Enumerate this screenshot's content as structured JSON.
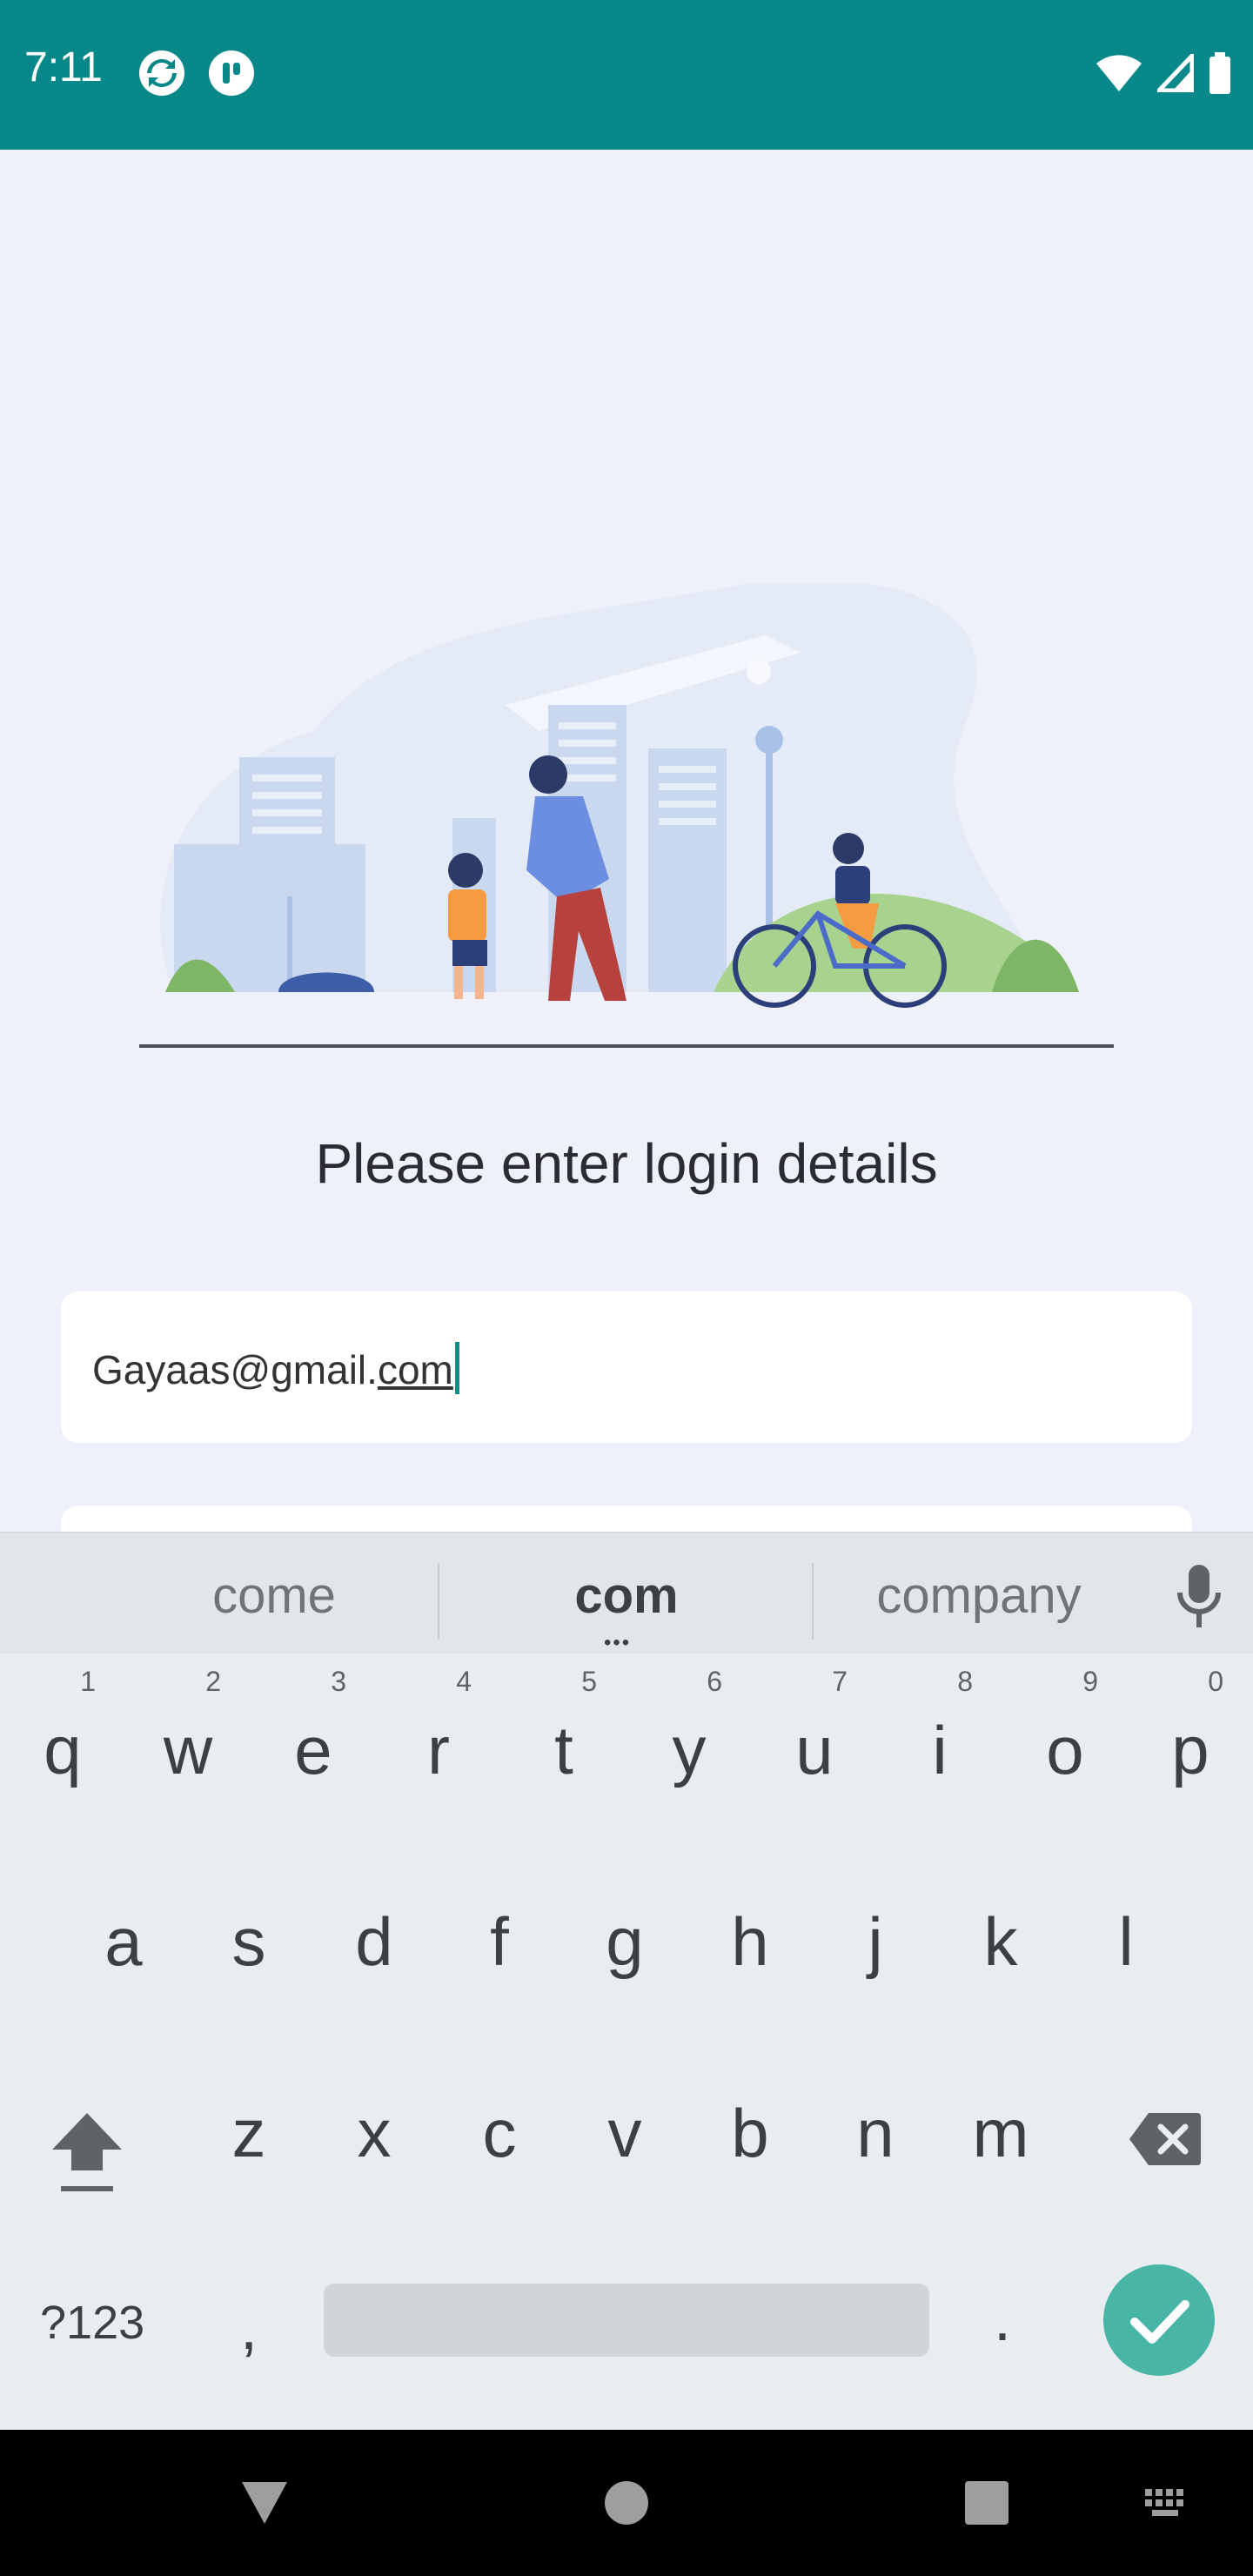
{
  "status_bar": {
    "time": "7:11",
    "icons_left": [
      "sync-icon",
      "app-notification-icon"
    ],
    "icons_right": [
      "wifi-icon",
      "signal-icon",
      "battery-icon"
    ],
    "color": "#088889"
  },
  "main": {
    "illustration": "family-park-scene",
    "heading": "Please enter login details",
    "email_field": {
      "value_prefix": "Gayaas@gmail.",
      "value_suffix": "com"
    }
  },
  "keyboard": {
    "suggestions": [
      "come",
      "com",
      "company"
    ],
    "row1": [
      {
        "key": "q",
        "hint": "1"
      },
      {
        "key": "w",
        "hint": "2"
      },
      {
        "key": "e",
        "hint": "3"
      },
      {
        "key": "r",
        "hint": "4"
      },
      {
        "key": "t",
        "hint": "5"
      },
      {
        "key": "y",
        "hint": "6"
      },
      {
        "key": "u",
        "hint": "7"
      },
      {
        "key": "i",
        "hint": "8"
      },
      {
        "key": "o",
        "hint": "9"
      },
      {
        "key": "p",
        "hint": "0"
      }
    ],
    "row2": [
      "a",
      "s",
      "d",
      "f",
      "g",
      "h",
      "j",
      "k",
      "l"
    ],
    "row3": [
      "z",
      "x",
      "c",
      "v",
      "b",
      "n",
      "m"
    ],
    "symbols_label": "?123",
    "comma": ",",
    "period": ".",
    "accent": "#48B5A7"
  },
  "nav_bar": {
    "buttons": [
      "back-icon",
      "home-icon",
      "recents-icon",
      "keyboard-switch-icon"
    ]
  }
}
